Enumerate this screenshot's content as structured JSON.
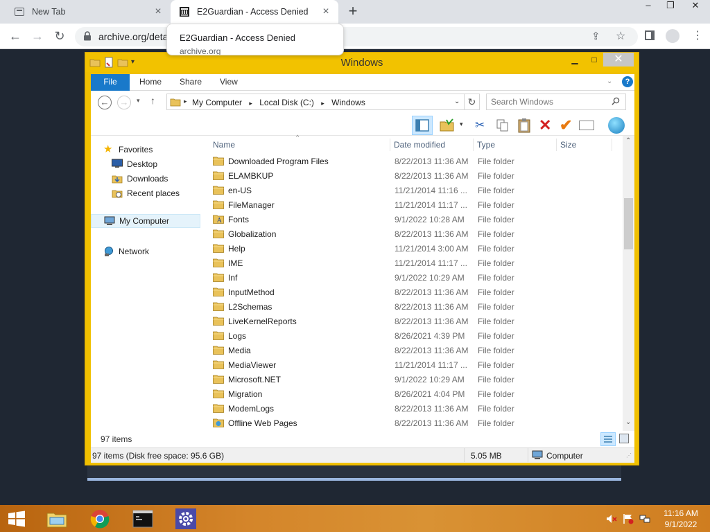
{
  "browser": {
    "tabs": [
      {
        "title": "New Tab"
      },
      {
        "title": "E2Guardian - Access Denied"
      }
    ],
    "url": "archive.org/deta",
    "tooltip": {
      "title": "E2Guardian - Access Denied",
      "subtitle": "archive.org"
    }
  },
  "explorer": {
    "title": "Windows",
    "ribbon_tabs": [
      "File",
      "Home",
      "Share",
      "View"
    ],
    "breadcrumbs": [
      "My Computer",
      "Local Disk (C:)",
      "Windows"
    ],
    "search_placeholder": "Search Windows",
    "nav": {
      "favorites": "Favorites",
      "desktop": "Desktop",
      "downloads": "Downloads",
      "recent": "Recent places",
      "mycomputer": "My Computer",
      "network": "Network"
    },
    "columns": {
      "name": "Name",
      "date": "Date modified",
      "type": "Type",
      "size": "Size"
    },
    "rows": [
      {
        "name": "Downloaded Program Files",
        "date": "8/22/2013 11:36 AM",
        "type": "File folder"
      },
      {
        "name": "ELAMBKUP",
        "date": "8/22/2013 11:36 AM",
        "type": "File folder"
      },
      {
        "name": "en-US",
        "date": "11/21/2014 11:16 ...",
        "type": "File folder"
      },
      {
        "name": "FileManager",
        "date": "11/21/2014 11:17 ...",
        "type": "File folder"
      },
      {
        "name": "Fonts",
        "date": "9/1/2022 10:28 AM",
        "type": "File folder"
      },
      {
        "name": "Globalization",
        "date": "8/22/2013 11:36 AM",
        "type": "File folder"
      },
      {
        "name": "Help",
        "date": "11/21/2014 3:00 AM",
        "type": "File folder"
      },
      {
        "name": "IME",
        "date": "11/21/2014 11:17 ...",
        "type": "File folder"
      },
      {
        "name": "Inf",
        "date": "9/1/2022 10:29 AM",
        "type": "File folder"
      },
      {
        "name": "InputMethod",
        "date": "8/22/2013 11:36 AM",
        "type": "File folder"
      },
      {
        "name": "L2Schemas",
        "date": "8/22/2013 11:36 AM",
        "type": "File folder"
      },
      {
        "name": "LiveKernelReports",
        "date": "8/22/2013 11:36 AM",
        "type": "File folder"
      },
      {
        "name": "Logs",
        "date": "8/26/2021 4:39 PM",
        "type": "File folder"
      },
      {
        "name": "Media",
        "date": "8/22/2013 11:36 AM",
        "type": "File folder"
      },
      {
        "name": "MediaViewer",
        "date": "11/21/2014 11:17 ...",
        "type": "File folder"
      },
      {
        "name": "Microsoft.NET",
        "date": "9/1/2022 10:29 AM",
        "type": "File folder"
      },
      {
        "name": "Migration",
        "date": "8/26/2021 4:04 PM",
        "type": "File folder"
      },
      {
        "name": "ModemLogs",
        "date": "8/22/2013 11:36 AM",
        "type": "File folder"
      },
      {
        "name": "Offline Web Pages",
        "date": "8/22/2013 11:36 AM",
        "type": "File folder"
      }
    ],
    "items_count": "97 items",
    "status": {
      "left": "97 items (Disk free space: 95.6 GB)",
      "size": "5.05 MB",
      "location": "Computer"
    }
  },
  "taskbar": {
    "time": "11:16 AM",
    "date": "9/1/2022"
  }
}
